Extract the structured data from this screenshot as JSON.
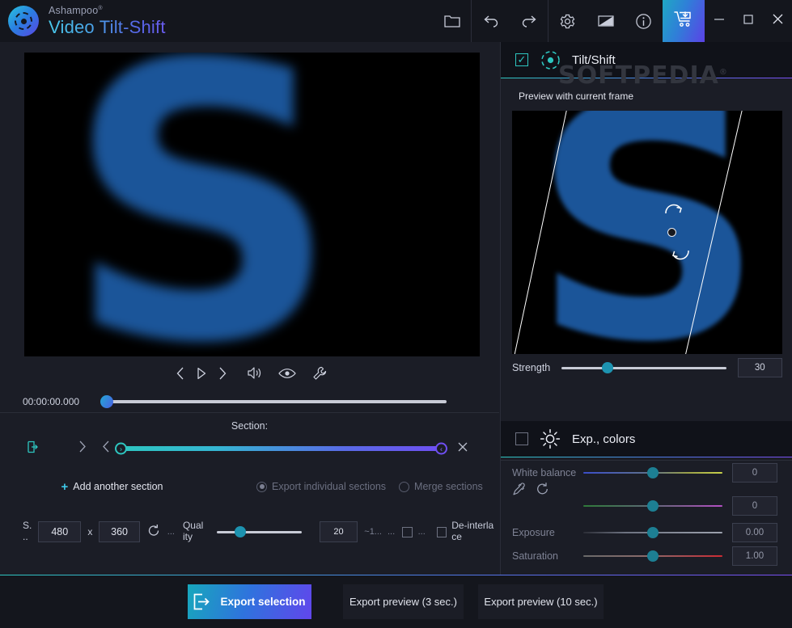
{
  "titlebar": {
    "brand_sup": "Ashampoo",
    "brand_sup_mark": "®",
    "brand_name": "Video Tilt-Shift",
    "icons": {
      "folder": "folder-icon",
      "undo": "undo-icon",
      "redo": "redo-icon",
      "settings": "gear-icon",
      "theme": "contrast-icon",
      "info": "info-icon",
      "cart": "shopping-cart-download-icon",
      "minimize": "minimize-icon",
      "maximize": "maximize-icon",
      "close": "close-icon"
    }
  },
  "player": {
    "time": "00:00:00.000",
    "controls": {
      "prev_frame": "prev-frame-icon",
      "play": "play-icon",
      "next_frame": "next-frame-icon",
      "volume": "volume-icon",
      "eye": "eye-icon",
      "wrench": "wrench-icon"
    },
    "timeline_position_pct": 2
  },
  "section": {
    "label": "Section:",
    "set_icon": "set-section-icon",
    "next_icon": "step-forward-icon",
    "prev_icon": "step-back-icon",
    "close_icon": "remove-section-icon",
    "start_handle": "›",
    "end_handle": "‹",
    "add_button": "Add another section",
    "add_button_plus": "+",
    "export_individual": "Export individual sections",
    "merge_sections": "Merge sections",
    "export_mode_selected": "export_individual"
  },
  "settings": {
    "size_label_line1": "S.",
    "size_label_line2": "..",
    "width": "480",
    "height": "360",
    "reset_icon": "reset-icon",
    "ellipsis": "...",
    "quality_label_line1": "Qual",
    "quality_label_line2": "ity",
    "quality_value": "20",
    "bitrate_hint": "~1...",
    "ellipsis2": "...",
    "ellipsis3": "...",
    "deinterlace_line1": "De-interla",
    "deinterlace_line2": "ce"
  },
  "tiltshift": {
    "enabled": true,
    "title": "Tilt/Shift",
    "icon": "tilt-shift-icon",
    "preview_button": "Preview with current frame",
    "rotate_cw_icon": "rotate-cw-icon",
    "rotate_ccw_icon": "rotate-ccw-icon",
    "center_handle": "center-handle",
    "strength_label": "Strength",
    "strength_value": "30",
    "strength_pct": 24
  },
  "expcolors": {
    "enabled": false,
    "title": "Exp., colors",
    "icon": "brightness-sun-icon",
    "white_balance_label": "White balance",
    "eyedropper_icon": "eyedropper-icon",
    "reset_icon": "reset-icon",
    "wb_temp_value": "0",
    "wb_tint_value": "0",
    "exposure_label": "Exposure",
    "exposure_value": "0.00",
    "saturation_label": "Saturation",
    "saturation_value": "1.00"
  },
  "bottom": {
    "export_selection": "Export selection",
    "export_selection_icon": "export-icon",
    "export_preview_3": "Export preview (3 sec.)",
    "export_preview_10": "Export preview (10 sec.)"
  },
  "watermark": {
    "text": "SOFTPEDIA",
    "mark": "®"
  },
  "colors": {
    "accent_teal": "#2ec6c0",
    "accent_purple": "#7a4ff3",
    "window_bg": "#1b1d26",
    "panel_bg": "#14161d",
    "video_blue": "#1b5599"
  }
}
